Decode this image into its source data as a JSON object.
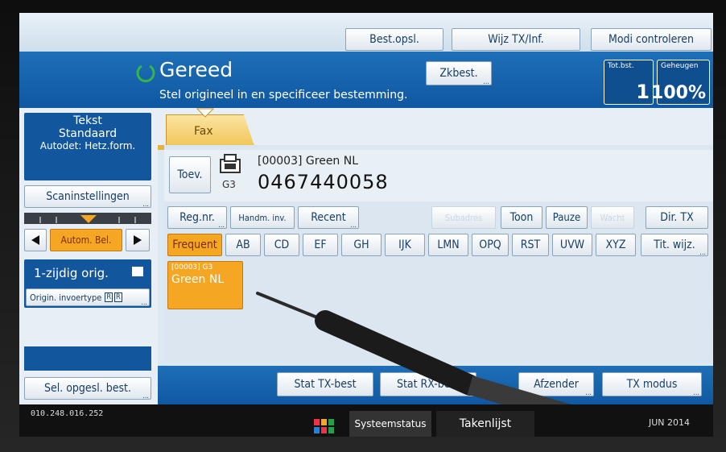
{
  "top": {
    "best_opsl": "Best.opsl.",
    "wijz_tx": "Wijz TX/Inf.",
    "modi": "Modi controleren"
  },
  "status": {
    "ready": "Gereed",
    "instruction": "Stel origineel in en specificeer bestemming.",
    "zkbest": "Zkbest.",
    "tot_label": "Tot.bst.",
    "tot_value": "1",
    "mem_label": "Geheugen",
    "mem_value": "100%"
  },
  "left": {
    "text_mode": "Tekst",
    "quality": "Standaard",
    "autodet": "Autodet: Hetz.form.",
    "scan_settings": "Scaninstellingen",
    "autom_bel": "Autom. Bel.",
    "one_sided": "1-zijdig orig.",
    "origin_type": "Origin. invoertype",
    "sel_saved": "Sel. opgesl. best."
  },
  "tab": {
    "fax": "Fax"
  },
  "destination": {
    "add": "Toev.",
    "entry": "[00003] Green NL",
    "mode": "G3",
    "number": "0467440058"
  },
  "row1": {
    "regnr": "Reg.nr.",
    "handm": "Handm. inv.",
    "recent": "Recent",
    "disabled1": "Subadres",
    "toon": "Toon",
    "pauze": "Pauze",
    "disabled2": "Wacht",
    "dir_tx": "Dir. TX"
  },
  "index_tabs": [
    "Frequent",
    "AB",
    "CD",
    "EF",
    "GH",
    "IJK",
    "LMN",
    "OPQ",
    "RST",
    "UVW",
    "XYZ"
  ],
  "tit_wijz": "Tit. wijz.",
  "entry_card": {
    "code": "[00003] G3",
    "name": "Green NL"
  },
  "bottom": {
    "stat_tx": "Stat TX-best",
    "stat_rx": "Stat RX-best",
    "afzender": "Afzender",
    "tx_modus": "TX modus"
  },
  "statusbar": {
    "ip": "010.248.016.252",
    "system_status": "Systeemstatus",
    "tasks": "Takenlijst",
    "date": "JUN 2014"
  },
  "colors": {
    "accent_blue": "#1466b0",
    "selected_orange": "#f5a623",
    "ready_green": "#35b54a"
  }
}
